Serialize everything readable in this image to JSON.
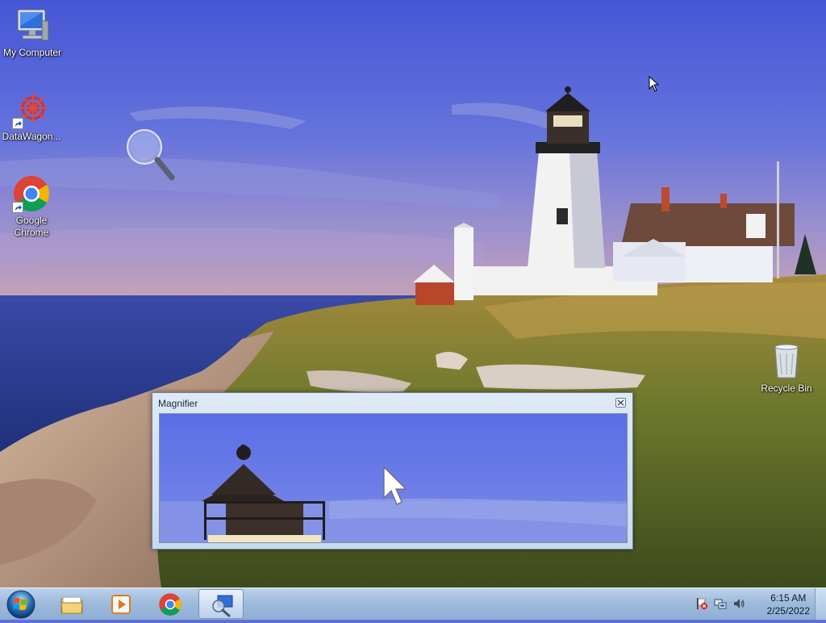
{
  "desktop": {
    "icons": [
      {
        "label": "My Computer",
        "icon": "computer-icon"
      },
      {
        "label": "DataWagon...",
        "icon": "datawagon-icon"
      },
      {
        "label": "Google Chrome",
        "label_lines": [
          "Google",
          "Chrome"
        ],
        "icon": "chrome-icon"
      },
      {
        "label": "Recycle Bin",
        "icon": "recycle-bin-icon"
      }
    ]
  },
  "magnifier": {
    "title": "Magnifier",
    "close_icon": "close-icon"
  },
  "taskbar": {
    "start_icon": "windows-orb-icon",
    "pinned": [
      {
        "icon": "file-explorer-icon",
        "name": "file-explorer"
      },
      {
        "icon": "media-player-icon",
        "name": "media-player"
      },
      {
        "icon": "chrome-icon",
        "name": "chrome"
      },
      {
        "icon": "magnifier-icon",
        "name": "magnifier",
        "active": true
      }
    ],
    "tray": {
      "icons": [
        "action-center-flag-icon",
        "network-icon",
        "volume-icon"
      ],
      "time": "6:15 AM",
      "date": "2/25/2022"
    }
  },
  "colors": {
    "sky_top": "#4f5fd8",
    "sea": "#2f47a8",
    "taskbar": "#a9c3e2",
    "window_frame": "#d2e0f1"
  }
}
